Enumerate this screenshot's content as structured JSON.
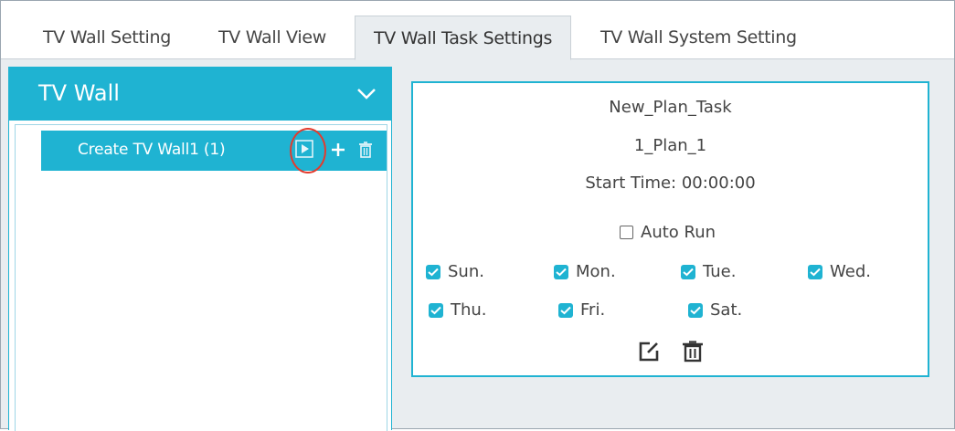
{
  "tabs": [
    {
      "label": "TV Wall Setting"
    },
    {
      "label": "TV Wall View"
    },
    {
      "label": "TV Wall Task Settings",
      "active": true
    },
    {
      "label": "TV Wall System Setting"
    }
  ],
  "left_panel": {
    "title": "TV Wall",
    "items": [
      {
        "label": "Create TV Wall1 (1)"
      }
    ]
  },
  "plan": {
    "name": "New_Plan_Task",
    "plan_id": "1_Plan_1",
    "start_time": "Start Time: 00:00:00",
    "auto_run_label": "Auto Run",
    "auto_run_checked": false,
    "days": [
      {
        "label": "Sun.",
        "checked": true
      },
      {
        "label": "Mon.",
        "checked": true
      },
      {
        "label": "Tue.",
        "checked": true
      },
      {
        "label": "Wed.",
        "checked": true
      },
      {
        "label": "Thu.",
        "checked": true
      },
      {
        "label": "Fri.",
        "checked": true
      },
      {
        "label": "Sat.",
        "checked": true
      }
    ]
  },
  "colors": {
    "accent": "#1fb3d2",
    "highlight_circle": "#e23b2e"
  }
}
